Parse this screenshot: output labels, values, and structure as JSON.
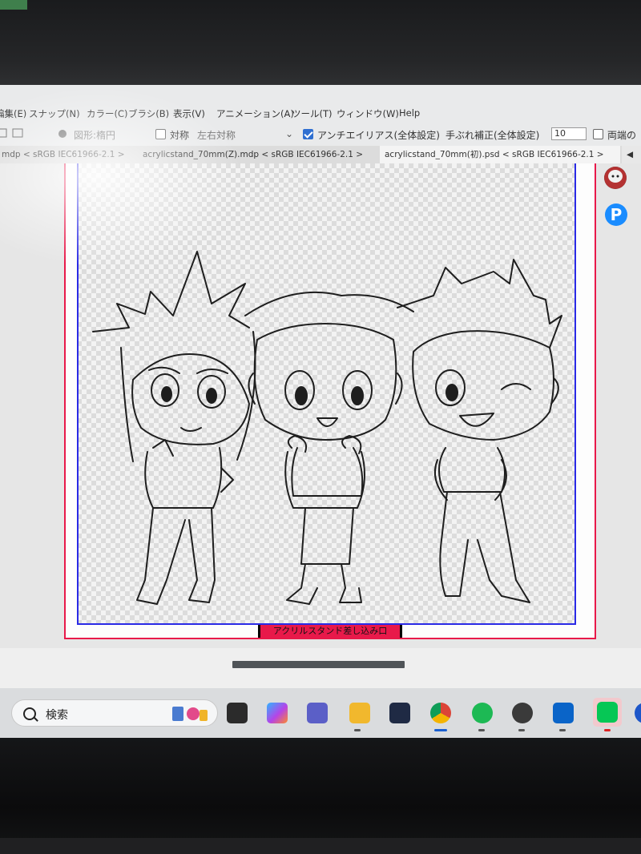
{
  "menu": {
    "items": [
      "編集(E)",
      "スナップ(N)",
      "カラー(C)",
      "ブラシ(B)",
      "表示(V)",
      "アニメーション(A)",
      "ツール(T)",
      "ウィンドウ(W)",
      "Help"
    ]
  },
  "options": {
    "shape_label": "図形:楕円",
    "symmetry_label": "対称",
    "symmetry_value": "左右対称",
    "antialias_label": "アンチエイリアス(全体設定)",
    "antialias_checked": true,
    "smoothing_label": "手ぶれ補正(全体設定)",
    "smoothing_value": "10",
    "both_ends_label": "両端の"
  },
  "tabs": [
    {
      "label": "mdp < sRGB IEC61966-2.1 >"
    },
    {
      "label": "acrylicstand_70mm(Z).mdp < sRGB IEC61966-2.1 >"
    },
    {
      "label": "acrylicstand_70mm(初).psd < sRGB IEC61966-2.1 >"
    }
  ],
  "canvas": {
    "stand_slot_label": "アクリルスタンド差し込み口"
  },
  "side_panel": {
    "pixiv_letter": "P"
  },
  "taskbar": {
    "search_placeholder": "検索",
    "apps": [
      "Widgets",
      "Copilot",
      "Teams",
      "File Explorer",
      "Microsoft Store",
      "Chrome",
      "Spotify",
      "Character app",
      "Outlook",
      "LINE"
    ]
  },
  "colors": {
    "template_frame": "#e8194a",
    "safe_area": "#2a2ae6",
    "pixiv": "#1a8cff",
    "line_app": "#06c755"
  }
}
